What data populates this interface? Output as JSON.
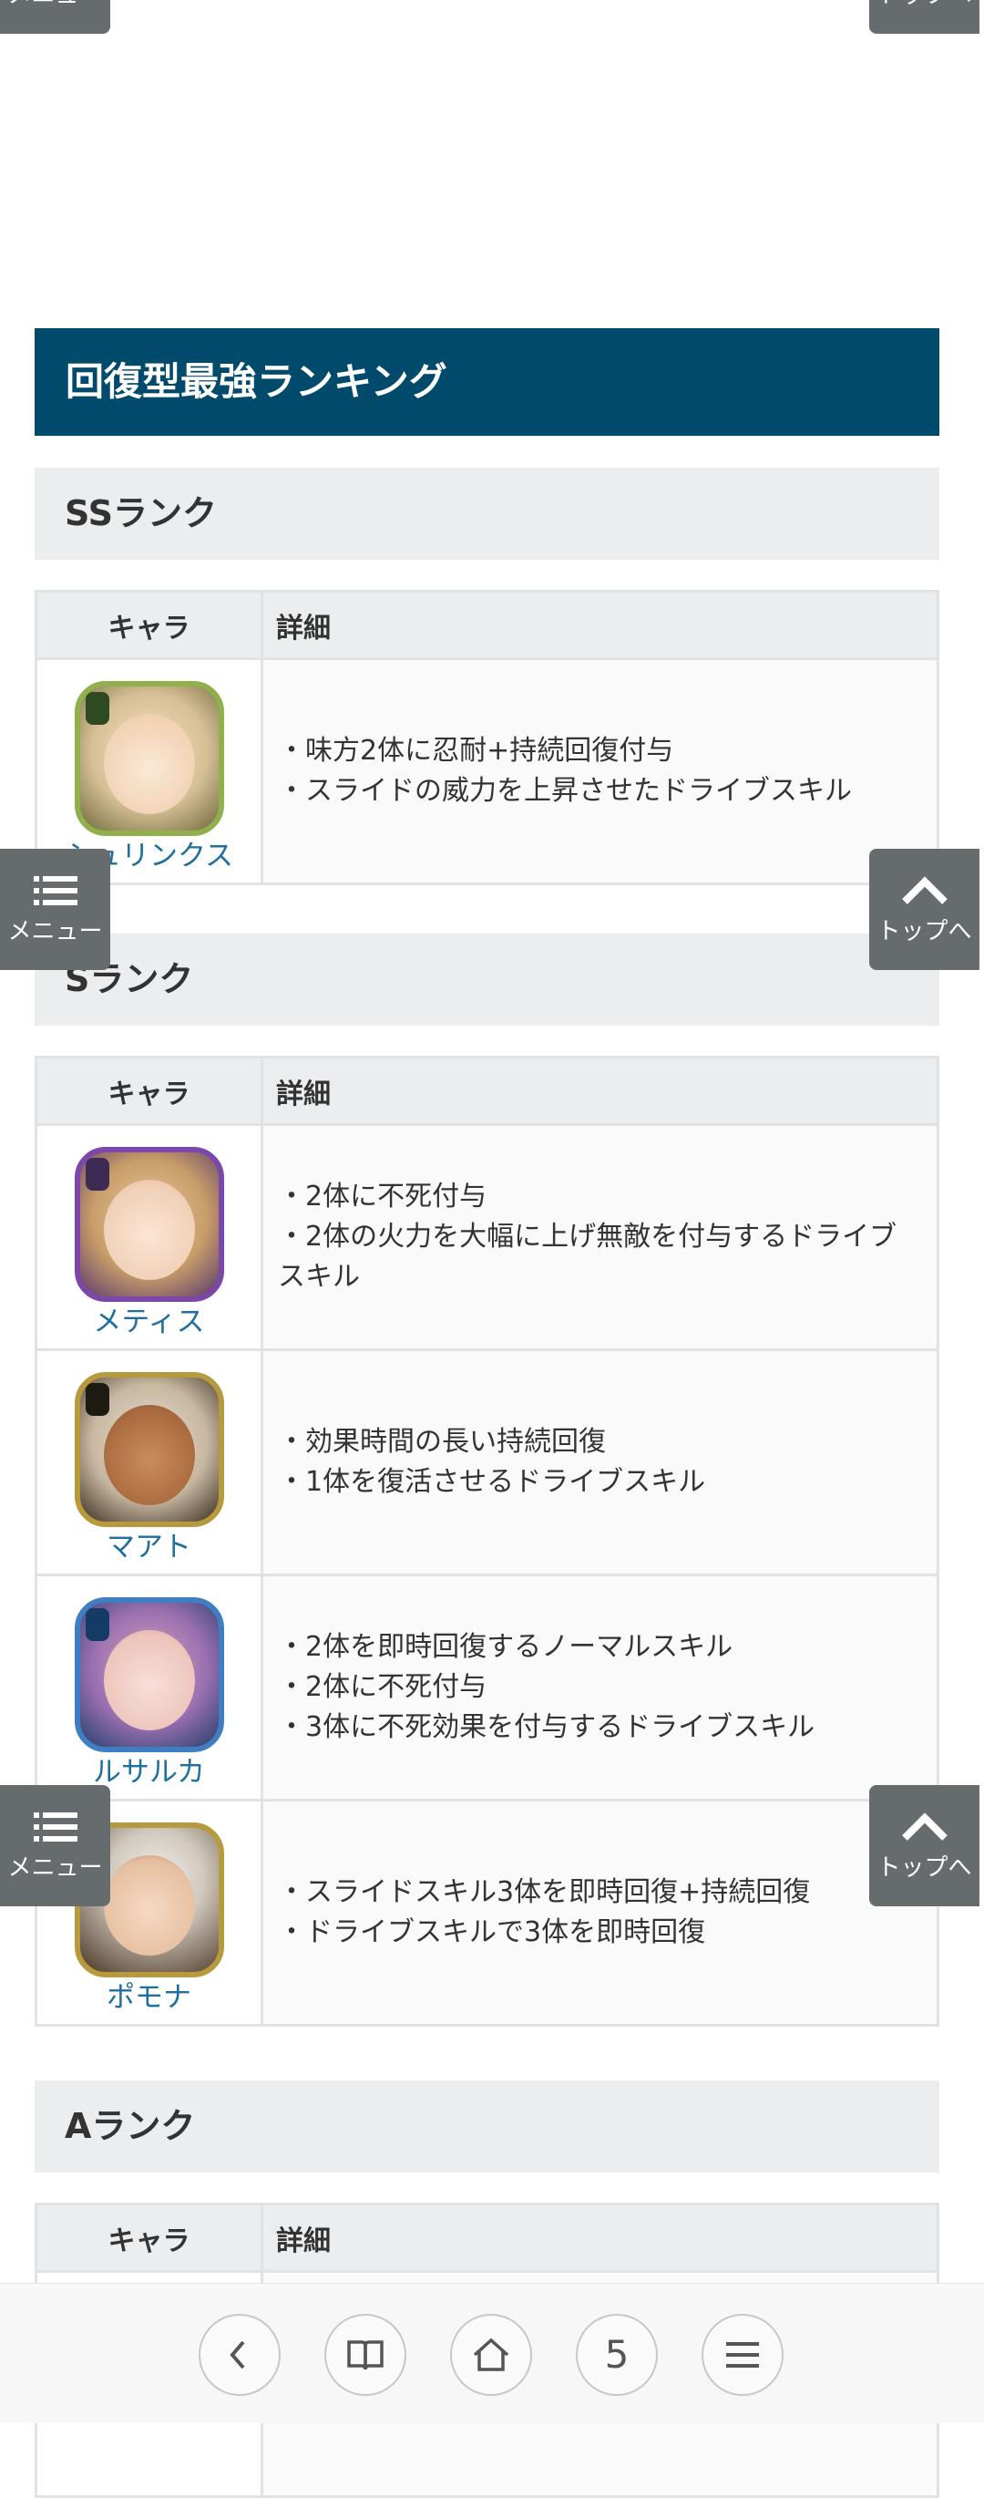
{
  "side_buttons": {
    "menu_label": "メニュー",
    "top_label": "トップへ"
  },
  "section": {
    "title": "回復型最強ランキング"
  },
  "table_headers": {
    "character": "キャラ",
    "detail": "詳細"
  },
  "ranks": [
    {
      "title": "SSランク",
      "rows": [
        {
          "name": "シュリンクス",
          "details": [
            "・味方2体に忍耐+持続回復付与",
            "・スライドの威力を上昇させたドライブスキル"
          ]
        }
      ]
    },
    {
      "title": "Sランク",
      "rows": [
        {
          "name": "メティス",
          "details": [
            "・2体に不死付与",
            "・2体の火力を大幅に上げ無敵を付与するドライブスキル"
          ]
        },
        {
          "name": "マアト",
          "details": [
            "・効果時間の長い持続回復",
            "・1体を復活させるドライブスキル"
          ]
        },
        {
          "name": "ルサルカ",
          "details": [
            "・2体を即時回復するノーマルスキル",
            "・2体に不死付与",
            "・3体に不死効果を付与するドライブスキル"
          ]
        },
        {
          "name": "ポモナ",
          "details": [
            "・スライドスキル3体を即時回復+持続回復",
            "・ドライブスキルで3体を即時回復"
          ]
        }
      ]
    },
    {
      "title": "Aランク",
      "rows": []
    }
  ],
  "bottom_nav": {
    "tab_count": "5",
    "icons": [
      "back-icon",
      "bookmarks-icon",
      "home-icon",
      "tabs-icon",
      "menu-icon"
    ]
  },
  "colors": {
    "header_bg": "#004a6b",
    "subheader_bg": "#ebedef",
    "link": "#1f6f9e",
    "side_button_bg": "#666b6e"
  }
}
